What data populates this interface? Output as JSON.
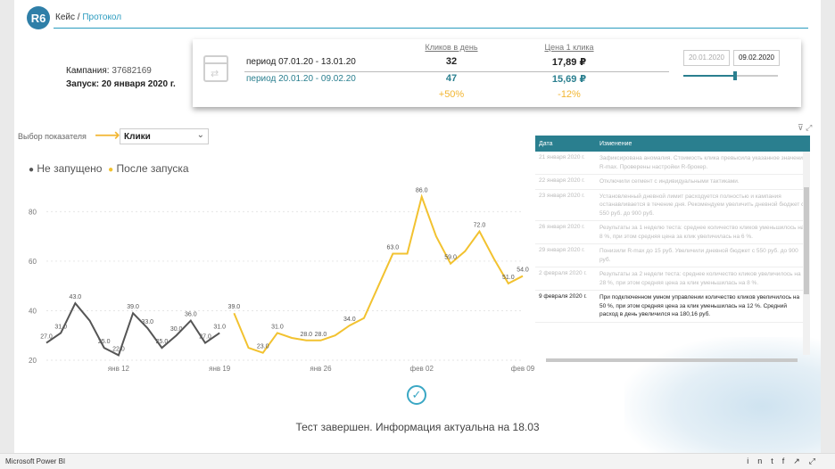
{
  "header": {
    "logo": "R6",
    "crumb_home": "Кейс",
    "crumb_sep": " / ",
    "crumb_current": "Протокол"
  },
  "campaign": {
    "label": "Кампания:",
    "id": "37682169",
    "launch_label": "Запуск:",
    "launch_date": "20 января 2020 г."
  },
  "summary": {
    "col_clicks": "Кликов в день",
    "col_price": "Цена 1 клика",
    "rows": [
      {
        "period": "период 07.01.20 - 13.01.20",
        "clicks": "32",
        "price": "17,89 ₽"
      },
      {
        "period": "период 20.01.20 - 09.02.20",
        "clicks": "47",
        "price": "15,69 ₽"
      }
    ],
    "delta_clicks": "+50%",
    "delta_price": "-12%",
    "date_from": "20.01.2020",
    "date_to": "09.02.2020",
    "slider_fraction": 0.55
  },
  "selector": {
    "label": "Выбор показателя",
    "value": "Клики"
  },
  "legend": {
    "before": "Не запущено",
    "after": "После запуска"
  },
  "colors": {
    "before": "#555555",
    "after": "#f2c230",
    "accent": "#2a7f8f"
  },
  "chart_data": {
    "type": "line",
    "yticks": [
      20,
      40,
      60,
      80
    ],
    "ylim": [
      20,
      92
    ],
    "xticks": [
      "янв 12",
      "янв 19",
      "янв 26",
      "фев 02",
      "фев 09"
    ],
    "x_start": "2020-01-07",
    "x_end": "2020-02-09",
    "series": [
      {
        "name": "Не запущено",
        "x": [
          "2020-01-07",
          "2020-01-08",
          "2020-01-09",
          "2020-01-10",
          "2020-01-11",
          "2020-01-12",
          "2020-01-13",
          "2020-01-14",
          "2020-01-15",
          "2020-01-16",
          "2020-01-17",
          "2020-01-18",
          "2020-01-19"
        ],
        "values": [
          27,
          31,
          43,
          36,
          25,
          22,
          39,
          33,
          25,
          30,
          36,
          27,
          31
        ]
      },
      {
        "name": "После запуска",
        "x": [
          "2020-01-20",
          "2020-01-21",
          "2020-01-22",
          "2020-01-23",
          "2020-01-24",
          "2020-01-25",
          "2020-01-26",
          "2020-01-27",
          "2020-01-28",
          "2020-01-29",
          "2020-01-30",
          "2020-01-31",
          "2020-02-01",
          "2020-02-02",
          "2020-02-03",
          "2020-02-04",
          "2020-02-05",
          "2020-02-06",
          "2020-02-07",
          "2020-02-08",
          "2020-02-09"
        ],
        "values": [
          39,
          25,
          23,
          31,
          29,
          28,
          28,
          30,
          34,
          37,
          50,
          63,
          63,
          86,
          70,
          59,
          64,
          72,
          61,
          51,
          54
        ]
      }
    ],
    "labels": [
      {
        "series": 0,
        "i": 0,
        "text": "27.0"
      },
      {
        "series": 0,
        "i": 1,
        "text": "31.0"
      },
      {
        "series": 0,
        "i": 2,
        "text": "43.0"
      },
      {
        "series": 0,
        "i": 4,
        "text": "25.0"
      },
      {
        "series": 0,
        "i": 5,
        "text": "22.0"
      },
      {
        "series": 0,
        "i": 6,
        "text": "39.0"
      },
      {
        "series": 0,
        "i": 7,
        "text": "33.0"
      },
      {
        "series": 0,
        "i": 8,
        "text": "25.0"
      },
      {
        "series": 0,
        "i": 9,
        "text": "30.0"
      },
      {
        "series": 0,
        "i": 10,
        "text": "36.0"
      },
      {
        "series": 0,
        "i": 11,
        "text": "27.0"
      },
      {
        "series": 0,
        "i": 12,
        "text": "31.0"
      },
      {
        "series": 1,
        "i": 0,
        "text": "39.0"
      },
      {
        "series": 1,
        "i": 2,
        "text": "23.0"
      },
      {
        "series": 1,
        "i": 3,
        "text": "31.0"
      },
      {
        "series": 1,
        "i": 6,
        "text": "28.0"
      },
      {
        "series": 1,
        "i": 5,
        "text": "28.0"
      },
      {
        "series": 1,
        "i": 8,
        "text": "34.0"
      },
      {
        "series": 1,
        "i": 11,
        "text": "63.0"
      },
      {
        "series": 1,
        "i": 13,
        "text": "86.0"
      },
      {
        "series": 1,
        "i": 15,
        "text": "59.0"
      },
      {
        "series": 1,
        "i": 17,
        "text": "72.0"
      },
      {
        "series": 1,
        "i": 19,
        "text": "51.0"
      },
      {
        "series": 1,
        "i": 20,
        "text": "54.0"
      }
    ]
  },
  "table": {
    "col_date": "Дата",
    "col_change": "Изменение",
    "rows": [
      {
        "date": "21 января 2020 г.",
        "text": "Зафиксирована аномалия. Стоимость клика превысила указанное значение R-max. Проверены настройки R-брокер.",
        "active": false
      },
      {
        "date": "22 января 2020 г.",
        "text": "Отключили сегмент с индивидуальными тактиками.",
        "active": false
      },
      {
        "date": "23 января 2020 г.",
        "text": "Установленный дневной лимит расходуется полностью и кампания останавливается в течение дня. Рекомендуем увеличить дневной бюджет с 550 руб. до 900 руб.",
        "active": false
      },
      {
        "date": "26 января 2020 г.",
        "text": "Результаты за 1 неделю теста: среднее количество кликов уменьшилось на 8 %, при этом средняя цена за клик увеличилась на 6 %.",
        "active": false
      },
      {
        "date": "29 января 2020 г.",
        "text": "Понизили R-max до 15 руб. Увеличили дневной бюджет с 550 руб. до 900 руб.",
        "active": false
      },
      {
        "date": "2 февраля 2020 г.",
        "text": "Результаты за 2 недели теста: среднее количество кликов увеличилось на 28 %, при этом средняя цена за клик уменьшилась на 8 %.",
        "active": false
      },
      {
        "date": "9 февраля 2020 г.",
        "text": "При подключенном умном управлении количество кликов увеличилось на 50 %, при этом средняя цена за клик уменьшилась на 12 %. Средний расход в день увеличился на 180,16 руб.",
        "active": true
      }
    ]
  },
  "footer": {
    "message": "Тест завершен. Информация актуальна на 18.03"
  },
  "taskbar": {
    "app": "Microsoft Power BI"
  }
}
